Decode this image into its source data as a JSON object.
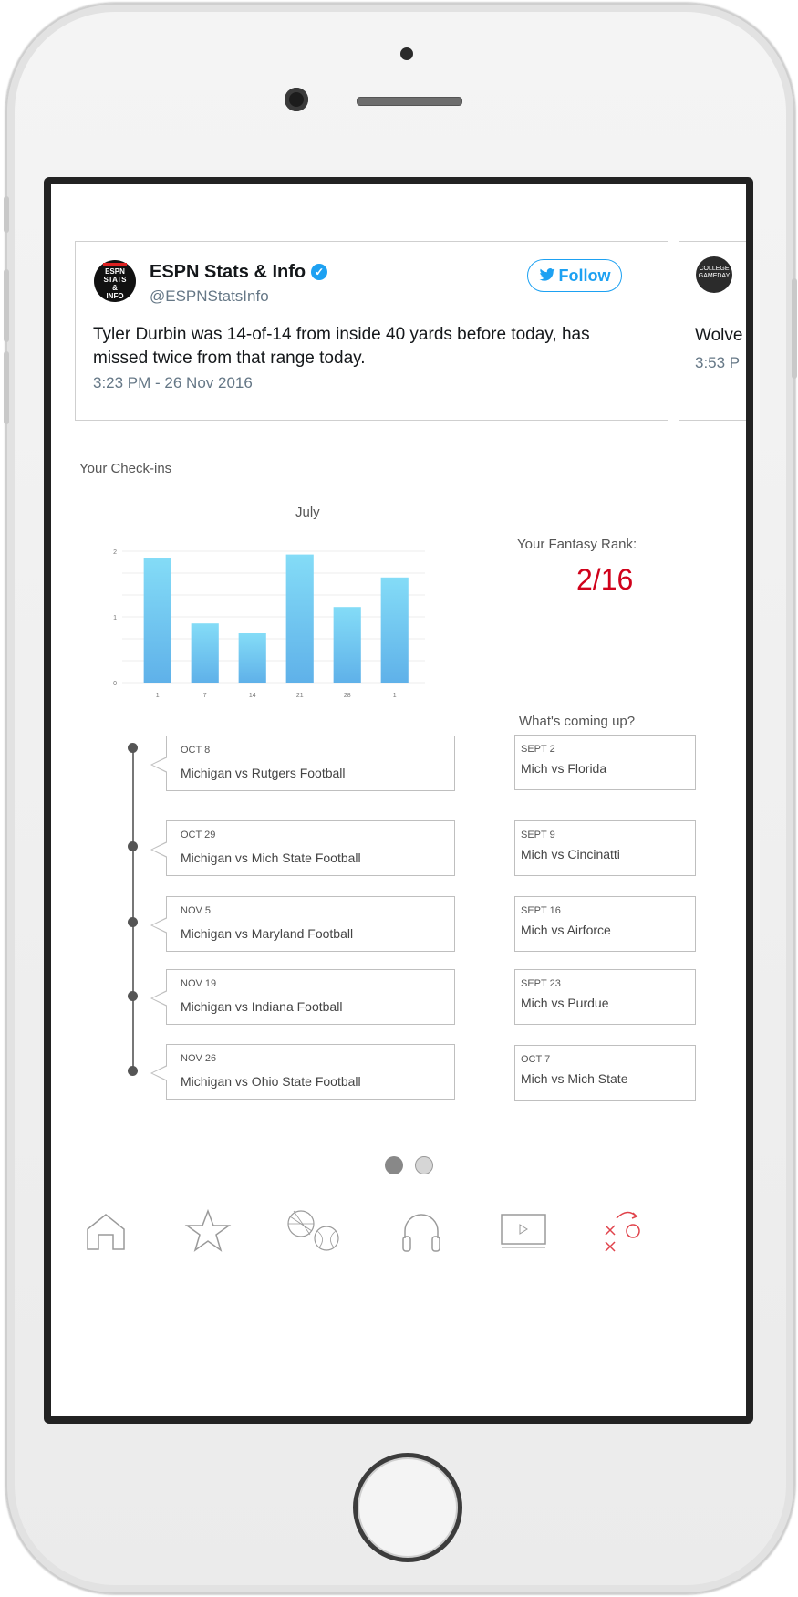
{
  "tweet": {
    "avatar_text": [
      "ESPN",
      "STATS",
      "&",
      "INFO"
    ],
    "name": "ESPN Stats & Info",
    "verified_mark": "✓",
    "handle": "@ESPNStatsInfo",
    "follow_label": "Follow",
    "text": "Tyler Durbin was 14-of-14 from inside 40 yards before today, has missed twice from that range today.",
    "time": "3:23 PM - 26 Nov 2016"
  },
  "tweet2": {
    "logo_text": "COLLEGE GAMEDAY",
    "text_partial": "Wolve",
    "time_partial": "3:53 P"
  },
  "checkins": {
    "label": "Your Check-ins"
  },
  "chart_data": {
    "type": "bar",
    "title": "July",
    "categories": [
      "1",
      "7",
      "14",
      "21",
      "28",
      "1"
    ],
    "values": [
      1.9,
      0.9,
      0.75,
      1.95,
      1.15,
      1.6
    ],
    "ylim": [
      0,
      2
    ],
    "yticks": [
      "0",
      "1",
      "2"
    ],
    "grid": true,
    "bar_color": "#6fc6f2"
  },
  "fantasy": {
    "label": "Your Fantasy Rank:",
    "rank": "2/16"
  },
  "upcoming": {
    "label": "What's coming up?",
    "items": [
      {
        "date": "SEPT 2",
        "title": "Mich vs Florida"
      },
      {
        "date": "SEPT 9",
        "title": "Mich vs Cincinatti"
      },
      {
        "date": "SEPT 16",
        "title": "Mich vs Airforce"
      },
      {
        "date": "SEPT 23",
        "title": "Mich vs Purdue"
      },
      {
        "date": "OCT 7",
        "title": "Mich vs Mich State"
      }
    ]
  },
  "history": {
    "items": [
      {
        "date": "OCT 8",
        "title": "Michigan vs Rutgers Football"
      },
      {
        "date": "OCT 29",
        "title": "Michigan vs Mich State Football"
      },
      {
        "date": "NOV 5",
        "title": "Michigan vs Maryland Football"
      },
      {
        "date": "NOV 19",
        "title": "Michigan vs Indiana Football"
      },
      {
        "date": "NOV 26",
        "title": "Michigan vs Ohio State Football"
      }
    ]
  },
  "pager": {
    "pages": 2,
    "active": 1
  },
  "tabbar": {
    "tabs": [
      {
        "icon": "home-icon",
        "active": false
      },
      {
        "icon": "star-icon",
        "active": false
      },
      {
        "icon": "sports-balls-icon",
        "active": false
      },
      {
        "icon": "headphones-icon",
        "active": false
      },
      {
        "icon": "video-play-icon",
        "active": false
      },
      {
        "icon": "playbook-icon",
        "active": true
      }
    ],
    "active_color": "#e0434b",
    "inactive_color": "#9a9a9a"
  }
}
